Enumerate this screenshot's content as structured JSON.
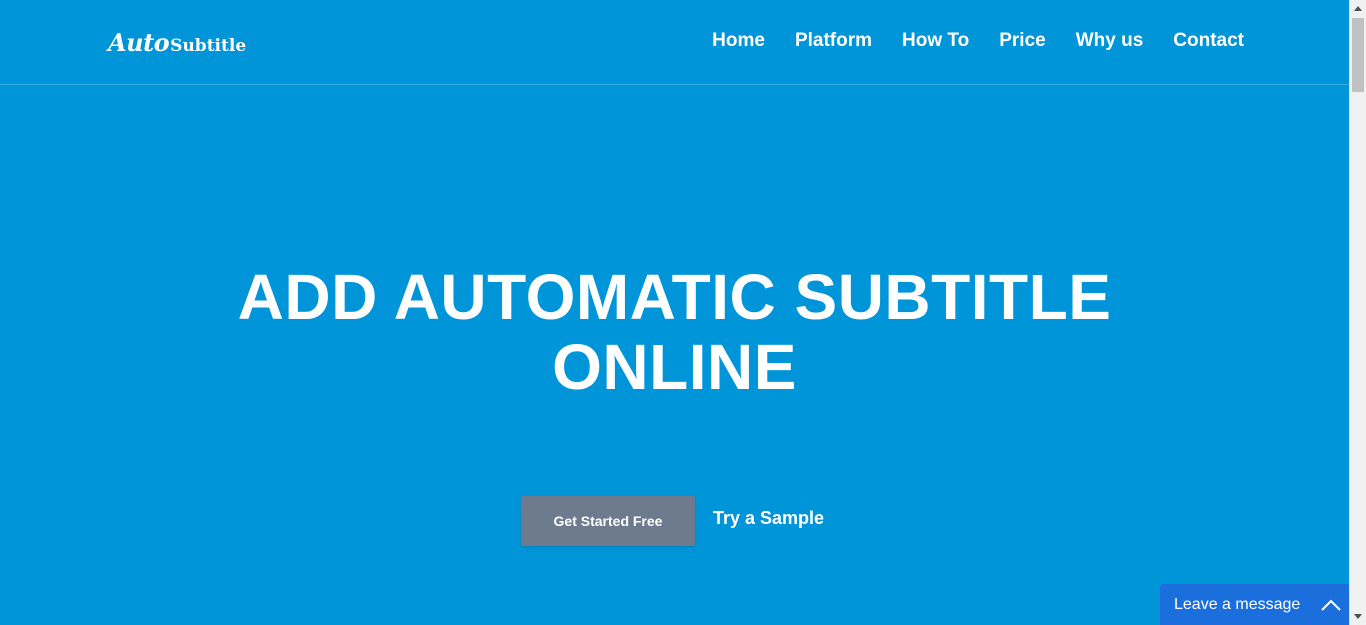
{
  "header": {
    "logo": {
      "script_part": "Auto",
      "bold_part": "Subtitle"
    },
    "nav": [
      {
        "label": "Home"
      },
      {
        "label": "Platform"
      },
      {
        "label": "How To"
      },
      {
        "label": "Price"
      },
      {
        "label": "Why us"
      },
      {
        "label": "Contact"
      }
    ]
  },
  "hero": {
    "title_line1": "ADD AUTOMATIC SUBTITLE",
    "title_line2": "ONLINE",
    "primary_button": "Get Started Free",
    "secondary_link": "Try a Sample"
  },
  "chat": {
    "label": "Leave a message",
    "icon": "chevron-up-icon",
    "background": "#1a6fdc"
  },
  "theme": {
    "background": "#0095d8",
    "primary_button_bg": "#6e7b8e",
    "text": "#ffffff"
  }
}
